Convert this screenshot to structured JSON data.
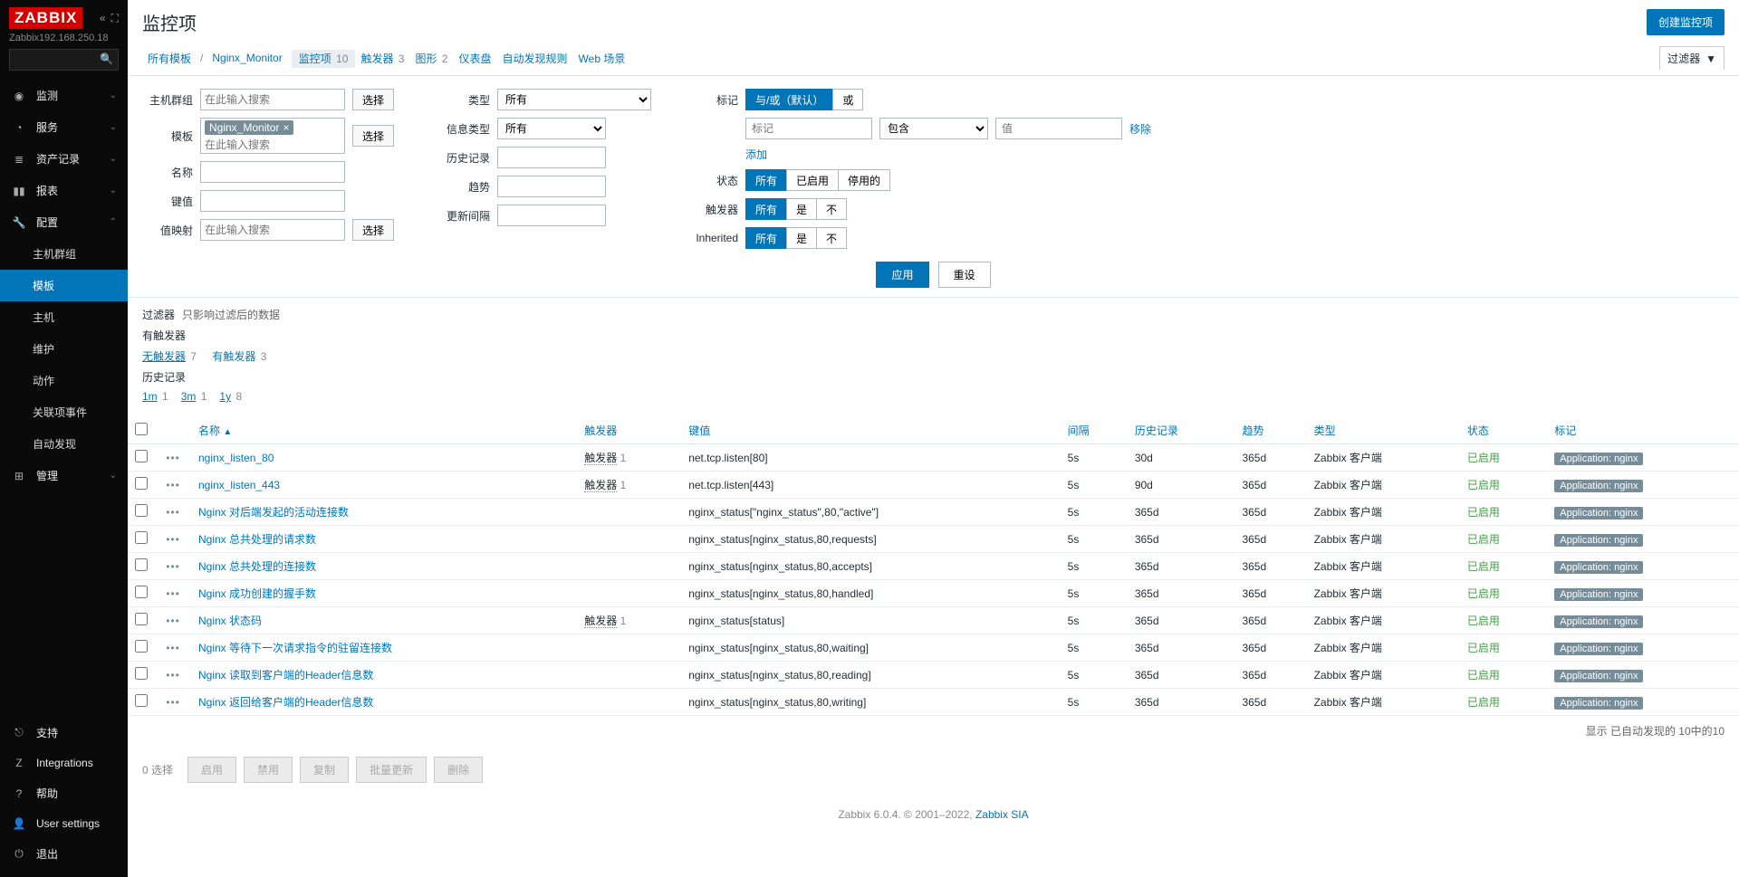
{
  "brand": "ZABBIX",
  "server_addr": "Zabbix192.168.250.18",
  "header": {
    "title": "监控项",
    "create_btn": "创建监控项"
  },
  "nav": {
    "top": [
      {
        "icon": "◉",
        "label": "监测",
        "chev": "⌄"
      },
      {
        "icon": "◔",
        "label": "服务",
        "chev": "⌄"
      },
      {
        "icon": "≣",
        "label": "资产记录",
        "chev": "⌄"
      },
      {
        "icon": "▮▮",
        "label": "报表",
        "chev": "⌄"
      },
      {
        "icon": "🔧",
        "label": "配置",
        "chev": "⌃",
        "expanded": true
      }
    ],
    "config_sub": [
      "主机群组",
      "模板",
      "主机",
      "维护",
      "动作",
      "关联项事件",
      "自动发现"
    ],
    "manage": {
      "icon": "⊞",
      "label": "管理",
      "chev": "⌄"
    },
    "bottom": [
      {
        "icon": "⎋",
        "label": "支持"
      },
      {
        "icon": "Z",
        "label": "Integrations"
      },
      {
        "icon": "?",
        "label": "帮助"
      },
      {
        "icon": "👤",
        "label": "User settings"
      },
      {
        "icon": "⏻",
        "label": "退出"
      }
    ]
  },
  "crumbs": {
    "all_templates": "所有模板",
    "template": "Nginx_Monitor",
    "tabs": [
      {
        "label": "监控项",
        "count": "10",
        "active": true
      },
      {
        "label": "触发器",
        "count": "3"
      },
      {
        "label": "图形",
        "count": "2"
      },
      {
        "label": "仪表盘",
        "count": ""
      },
      {
        "label": "自动发现规则",
        "count": ""
      },
      {
        "label": "Web 场景",
        "count": ""
      }
    ],
    "filter_label": "过滤器"
  },
  "filter": {
    "labels": {
      "host_group": "主机群组",
      "template": "模板",
      "name": "名称",
      "key": "键值",
      "value_map": "值映射",
      "type": "类型",
      "info_type": "信息类型",
      "history": "历史记录",
      "trends": "趋势",
      "update": "更新间隔",
      "tags": "标记",
      "status": "状态",
      "triggers": "触发器",
      "inherited": "Inherited"
    },
    "placeholder": "在此输入搜索",
    "select_btn": "选择",
    "template_tag": "Nginx_Monitor",
    "type_all": "所有",
    "info_all": "所有",
    "tag_mode": [
      "与/或（默认）",
      "或"
    ],
    "tag_row": {
      "name_ph": "标记",
      "op": "包含",
      "val_ph": "值",
      "remove": "移除",
      "add": "添加"
    },
    "status_opts": [
      "所有",
      "已启用",
      "停用的"
    ],
    "trig_opts": [
      "所有",
      "是",
      "不"
    ],
    "inh_opts": [
      "所有",
      "是",
      "不"
    ],
    "apply": "应用",
    "reset": "重设"
  },
  "subfilter": {
    "title": "过滤器",
    "desc": "只影响过滤后的数据",
    "trig_title": "有触发器",
    "no_trig": "无触发器",
    "no_trig_cnt": "7",
    "has_trig": "有触发器",
    "has_trig_cnt": "3",
    "hist_title": "历史记录",
    "hist": [
      {
        "k": "1m",
        "v": "1"
      },
      {
        "k": "3m",
        "v": "1"
      },
      {
        "k": "1y",
        "v": "8"
      }
    ]
  },
  "table": {
    "headers": {
      "name": "名称",
      "triggers": "触发器",
      "key": "键值",
      "interval": "间隔",
      "history": "历史记录",
      "trends": "趋势",
      "type": "类型",
      "status": "状态",
      "tags": "标记"
    },
    "trig_label": "触发器",
    "trig_cnt": "1",
    "type_val": "Zabbix 客户端",
    "status_val": "已启用",
    "tag_val": "Application: nginx",
    "rows": [
      {
        "name": "nginx_listen_80",
        "trig": true,
        "key": "net.tcp.listen[80]",
        "intv": "5s",
        "hist": "30d",
        "trend": "365d"
      },
      {
        "name": "nginx_listen_443",
        "trig": true,
        "key": "net.tcp.listen[443]",
        "intv": "5s",
        "hist": "90d",
        "trend": "365d"
      },
      {
        "name": "Nginx 对后端发起的活动连接数",
        "trig": false,
        "key": "nginx_status[\"nginx_status\",80,\"active\"]",
        "intv": "5s",
        "hist": "365d",
        "trend": "365d"
      },
      {
        "name": "Nginx 总共处理的请求数",
        "trig": false,
        "key": "nginx_status[nginx_status,80,requests]",
        "intv": "5s",
        "hist": "365d",
        "trend": "365d"
      },
      {
        "name": "Nginx 总共处理的连接数",
        "trig": false,
        "key": "nginx_status[nginx_status,80,accepts]",
        "intv": "5s",
        "hist": "365d",
        "trend": "365d"
      },
      {
        "name": "Nginx 成功创建的握手数",
        "trig": false,
        "key": "nginx_status[nginx_status,80,handled]",
        "intv": "5s",
        "hist": "365d",
        "trend": "365d"
      },
      {
        "name": "Nginx 状态码",
        "trig": true,
        "key": "nginx_status[status]",
        "intv": "5s",
        "hist": "365d",
        "trend": "365d"
      },
      {
        "name": "Nginx 等待下一次请求指令的驻留连接数",
        "trig": false,
        "key": "nginx_status[nginx_status,80,waiting]",
        "intv": "5s",
        "hist": "365d",
        "trend": "365d"
      },
      {
        "name": "Nginx 读取到客户端的Header信息数",
        "trig": false,
        "key": "nginx_status[nginx_status,80,reading]",
        "intv": "5s",
        "hist": "365d",
        "trend": "365d"
      },
      {
        "name": "Nginx 返回给客户端的Header信息数",
        "trig": false,
        "key": "nginx_status[nginx_status,80,writing]",
        "intv": "5s",
        "hist": "365d",
        "trend": "365d"
      }
    ],
    "footer": "显示 已自动发现的 10中的10"
  },
  "bottom": {
    "selected": "0 选择",
    "enable": "启用",
    "disable": "禁用",
    "copy": "复制",
    "massupdate": "批量更新",
    "delete": "删除"
  },
  "footer": {
    "text": "Zabbix 6.0.4. © 2001–2022, ",
    "link": "Zabbix SIA"
  }
}
